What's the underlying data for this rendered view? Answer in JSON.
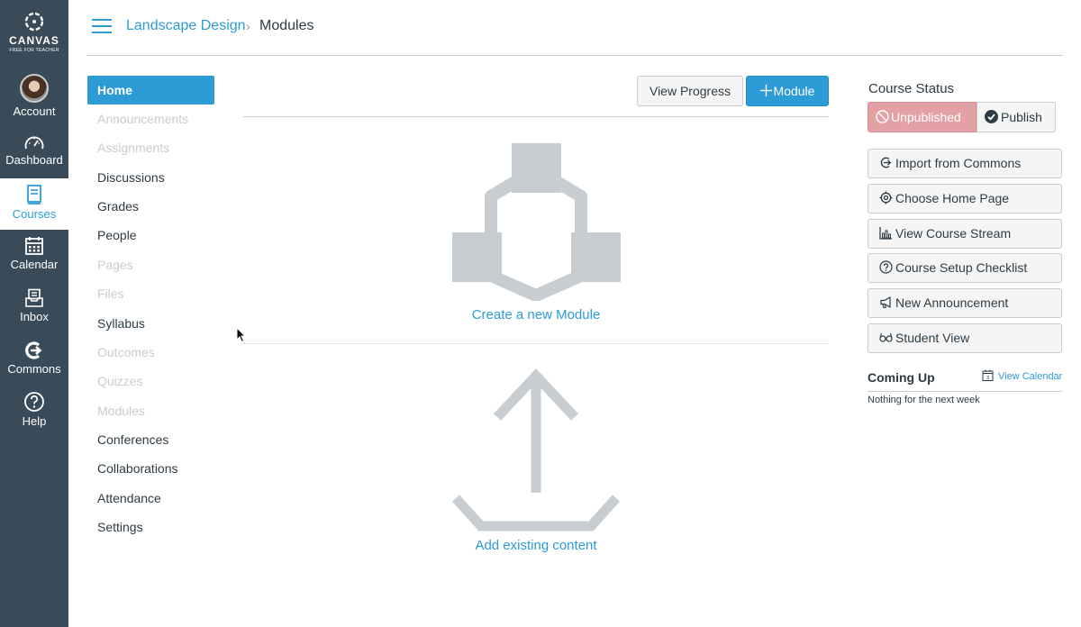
{
  "global_nav": {
    "brand": "CANVAS",
    "brand_sub": "FREE FOR TEACHER",
    "items": [
      {
        "label": "Account",
        "icon": "avatar"
      },
      {
        "label": "Dashboard",
        "icon": "dashboard-icon"
      },
      {
        "label": "Courses",
        "icon": "courses-icon",
        "active": true
      },
      {
        "label": "Calendar",
        "icon": "calendar-icon"
      },
      {
        "label": "Inbox",
        "icon": "inbox-icon"
      },
      {
        "label": "Commons",
        "icon": "commons-icon"
      },
      {
        "label": "Help",
        "icon": "help-icon"
      }
    ]
  },
  "header": {
    "course": "Landscape Design",
    "separator": "›",
    "current": "Modules"
  },
  "course_nav": [
    {
      "label": "Home",
      "state": "active"
    },
    {
      "label": "Announcements",
      "state": "disabled"
    },
    {
      "label": "Assignments",
      "state": "disabled"
    },
    {
      "label": "Discussions",
      "state": "enabled"
    },
    {
      "label": "Grades",
      "state": "enabled"
    },
    {
      "label": "People",
      "state": "enabled"
    },
    {
      "label": "Pages",
      "state": "disabled"
    },
    {
      "label": "Files",
      "state": "disabled"
    },
    {
      "label": "Syllabus",
      "state": "enabled"
    },
    {
      "label": "Outcomes",
      "state": "disabled"
    },
    {
      "label": "Quizzes",
      "state": "disabled"
    },
    {
      "label": "Modules",
      "state": "disabled"
    },
    {
      "label": "Conferences",
      "state": "enabled"
    },
    {
      "label": "Collaborations",
      "state": "enabled"
    },
    {
      "label": "Attendance",
      "state": "enabled"
    },
    {
      "label": "Settings",
      "state": "enabled"
    }
  ],
  "content": {
    "view_progress_label": "View Progress",
    "module_label": "Module",
    "create_module_link": "Create a new Module",
    "add_content_link": "Add existing content"
  },
  "sidebar": {
    "status_title": "Course Status",
    "unpublished_label": "Unpublished",
    "publish_label": "Publish",
    "buttons": [
      {
        "label": "Import from Commons",
        "icon": "commons-import-icon"
      },
      {
        "label": "Choose Home Page",
        "icon": "target-icon"
      },
      {
        "label": "View Course Stream",
        "icon": "stream-chart-icon"
      },
      {
        "label": "Course Setup Checklist",
        "icon": "question-circle-icon"
      },
      {
        "label": "New Announcement",
        "icon": "megaphone-icon"
      },
      {
        "label": "Student View",
        "icon": "glasses-icon"
      }
    ],
    "coming_up_title": "Coming Up",
    "view_calendar_label": "View Calendar",
    "coming_up_empty": "Nothing for the next week"
  },
  "colors": {
    "nav_bg": "#394b58",
    "accent": "#2d9bd6",
    "unpublished": "#e4a1a5",
    "illustration": "#c7cdd1"
  }
}
